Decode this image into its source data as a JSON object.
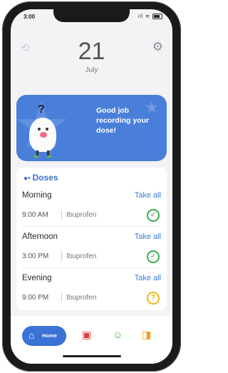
{
  "status_bar": {
    "time": "3:00",
    "signal": "ıll",
    "wifi": "≋"
  },
  "date": {
    "day": "21",
    "month": "July"
  },
  "banner": {
    "message": "Good job recording your dose!"
  },
  "doses": {
    "title": "Doses",
    "groups": [
      {
        "label": "Morning",
        "take_all": "Take all",
        "time": "9:00 AM",
        "medication": "Ibuprofen",
        "status": "taken"
      },
      {
        "label": "Afternoon",
        "take_all": "Take all",
        "time": "3:00 PM",
        "medication": "Ibuprofen",
        "status": "taken"
      },
      {
        "label": "Evening",
        "take_all": "Take all",
        "time": "9:00 PM",
        "medication": "Ibuprofen",
        "status": "unknown"
      }
    ]
  },
  "tabbar": {
    "home_label": "Home",
    "icons": [
      "home-icon",
      "medication-icon",
      "mood-icon",
      "notes-icon"
    ]
  },
  "colors": {
    "accent": "#3a72d6",
    "banner": "#4a7fd9",
    "taken": "#3aab4d",
    "pending": "#f2b418"
  }
}
